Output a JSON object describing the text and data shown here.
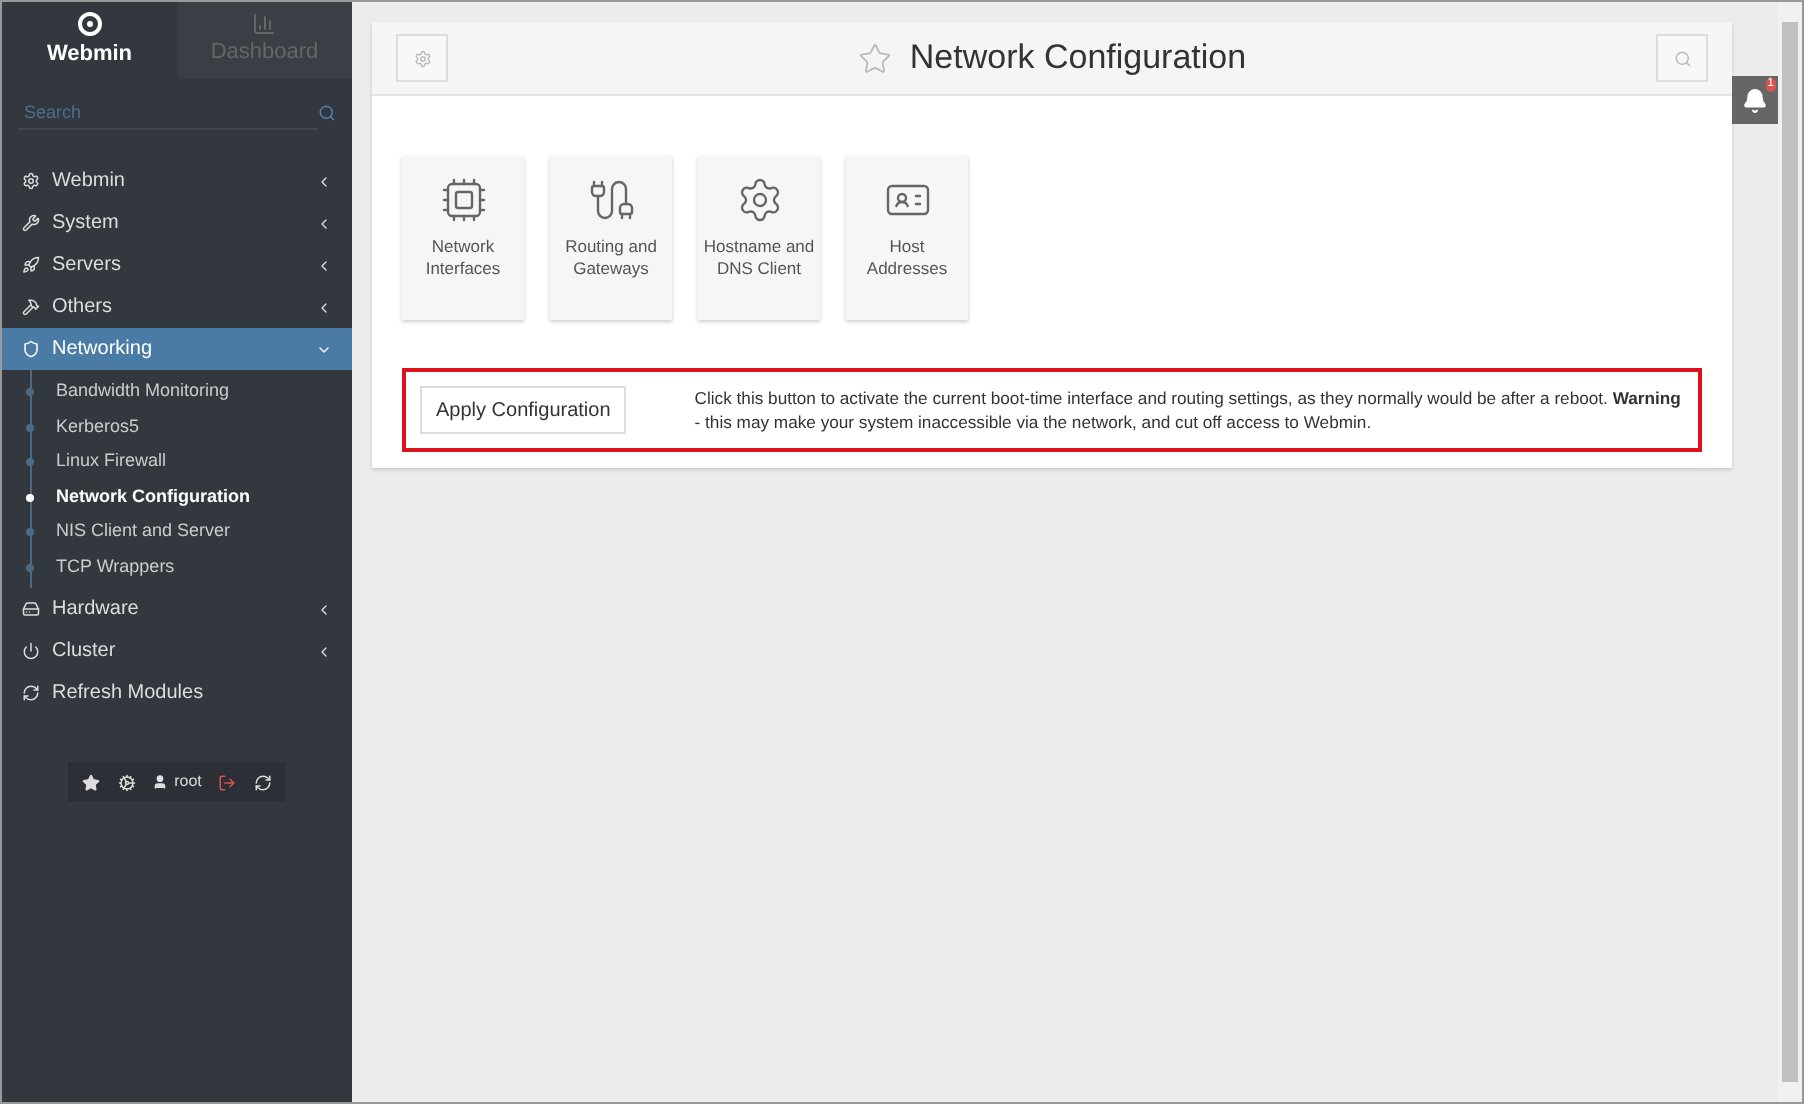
{
  "sidebar": {
    "tabs": [
      {
        "label": "Webmin",
        "selected": true
      },
      {
        "label": "Dashboard",
        "selected": false
      }
    ],
    "search": {
      "placeholder": "Search"
    },
    "items": [
      {
        "label": "Webmin",
        "kind": "group",
        "expanded": false
      },
      {
        "label": "System",
        "kind": "group",
        "expanded": false
      },
      {
        "label": "Servers",
        "kind": "group",
        "expanded": false
      },
      {
        "label": "Others",
        "kind": "group",
        "expanded": false
      },
      {
        "label": "Networking",
        "kind": "group",
        "expanded": true,
        "children": [
          {
            "label": "Bandwidth Monitoring",
            "selected": false
          },
          {
            "label": "Kerberos5",
            "selected": false
          },
          {
            "label": "Linux Firewall",
            "selected": false
          },
          {
            "label": "Network Configuration",
            "selected": true
          },
          {
            "label": "NIS Client and Server",
            "selected": false
          },
          {
            "label": "TCP Wrappers",
            "selected": false
          }
        ]
      },
      {
        "label": "Hardware",
        "kind": "group",
        "expanded": false
      },
      {
        "label": "Cluster",
        "kind": "group",
        "expanded": false
      },
      {
        "label": "Refresh Modules",
        "kind": "action",
        "expanded": false
      }
    ],
    "footer": {
      "user": "root"
    }
  },
  "page": {
    "title": "Network Configuration",
    "modules": [
      {
        "label": "Network Interfaces"
      },
      {
        "label": "Routing and Gateways"
      },
      {
        "label": "Hostname and DNS Client"
      },
      {
        "label": "Host Addresses"
      }
    ],
    "apply": {
      "button": "Apply Configuration",
      "text": "Click this button to activate the current boot-time interface and routing settings, as they normally would be after a reboot. **Warning** - this may make your system inaccessible via the network, and cut off access to Webmin."
    }
  },
  "notifications": {
    "count": "1"
  }
}
